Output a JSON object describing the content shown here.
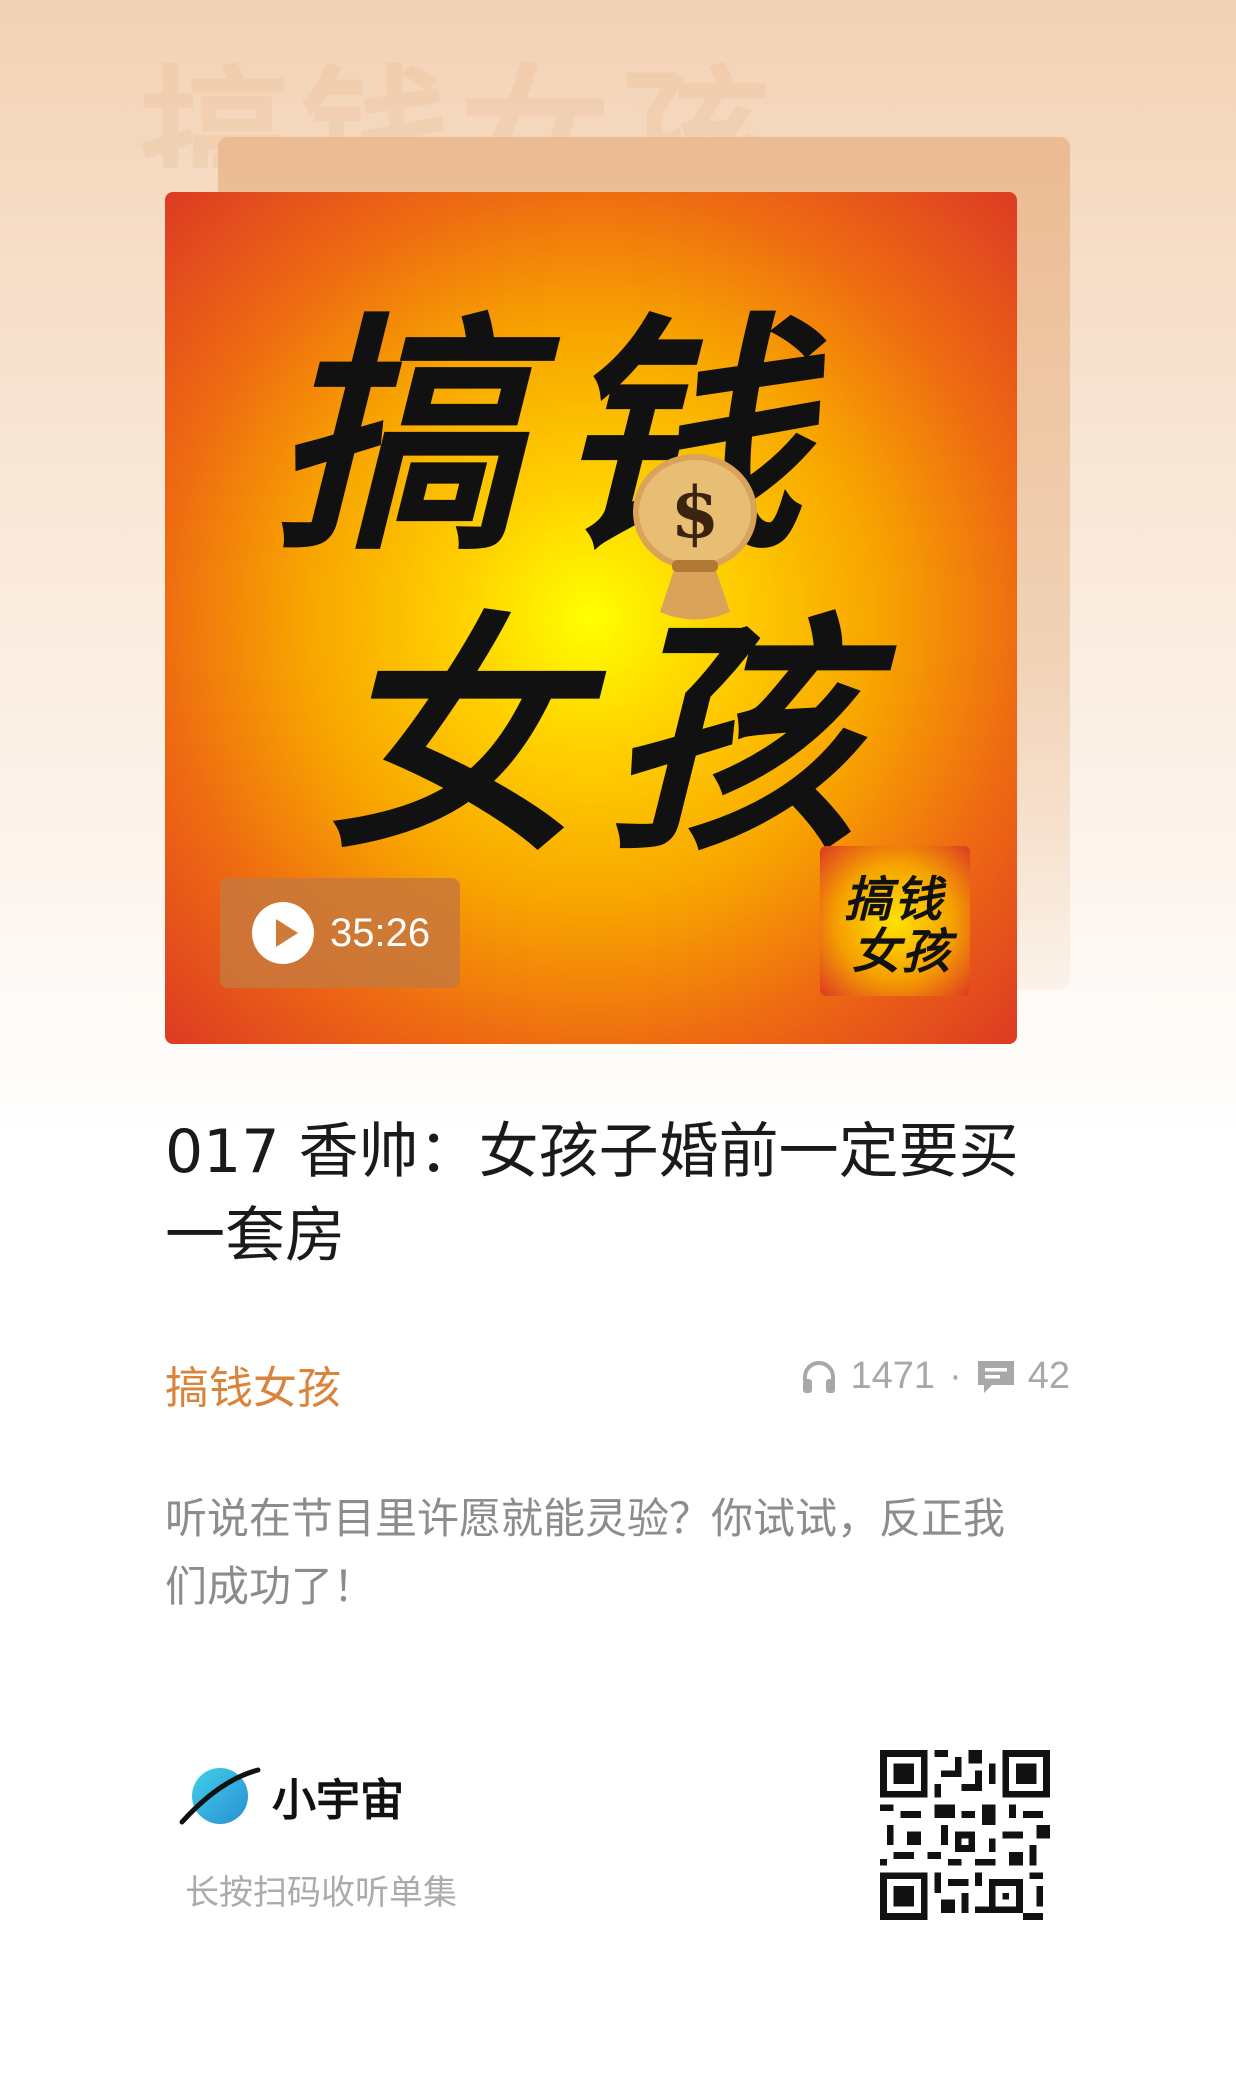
{
  "watermark": "搞钱女孩",
  "cover": {
    "title_line1": "搞钱",
    "title_line2": "女孩",
    "duration": "35:26",
    "mini_logo_line1": "搞钱",
    "mini_logo_line2": "女孩"
  },
  "episode": {
    "title": "017 香帅：女孩子婚前一定要买一套房",
    "podcast": "搞钱女孩",
    "plays": "1471",
    "separator": "·",
    "comments": "42",
    "description": "听说在节目里许愿就能灵验？你试试，反正我们成功了！"
  },
  "footer": {
    "brand": "小宇宙",
    "scan_hint": "长按扫码收听单集"
  },
  "colors": {
    "accent": "#d9843a",
    "cover_red": "#dd3a24",
    "cover_yellow": "#ffff00"
  },
  "icons": [
    "play-icon",
    "headphones-icon",
    "comment-icon",
    "planet-logo-icon",
    "qr-code"
  ]
}
